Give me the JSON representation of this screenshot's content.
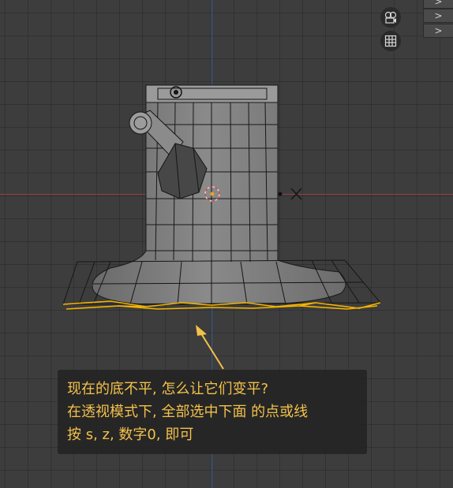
{
  "viewport": {
    "colors": {
      "background": "#3d3d3d",
      "mesh_fill": "#7d7d7d",
      "wireframe": "#141414",
      "selected_edges": "#f5b400",
      "x_axis": "#9b3c3f",
      "y_axis": "#3b5f99",
      "annotation": "#f3c14a"
    },
    "nav_gizmos": [
      {
        "name": "camera-view-icon"
      },
      {
        "name": "grid-perspective-icon"
      }
    ],
    "side_tabs": [
      ">",
      ">",
      ">"
    ]
  },
  "annotation": {
    "lines": [
      "现在的底不平, 怎么让它们变平?",
      "在透视模式下, 全部选中下面 的点或线",
      "按 s, z, 数字0,  即可"
    ]
  }
}
